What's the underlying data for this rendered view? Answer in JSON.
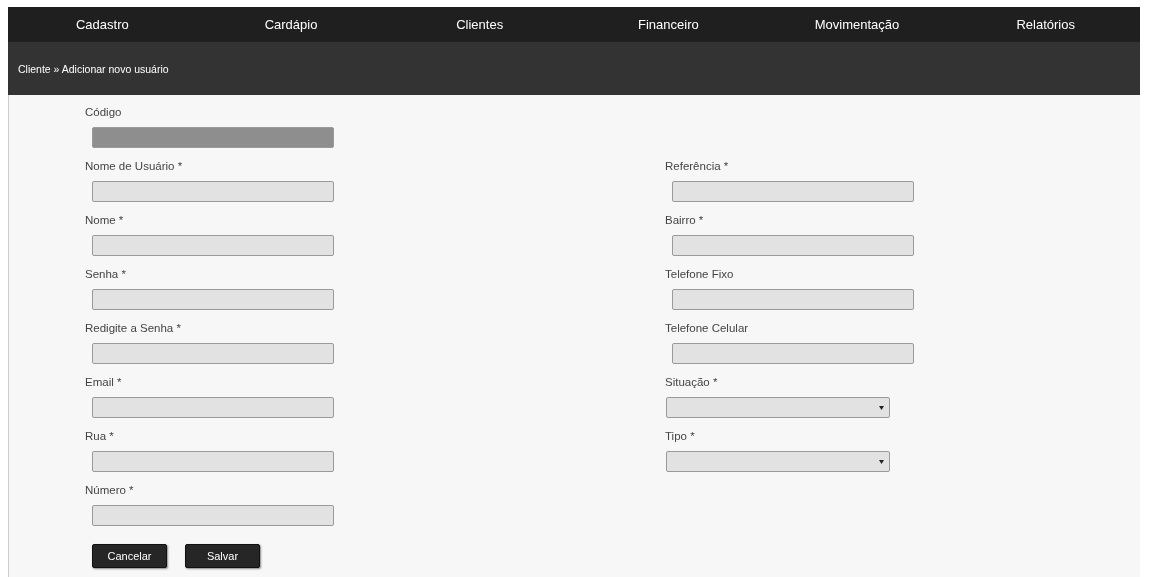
{
  "nav": {
    "items": [
      {
        "label": "Cadastro"
      },
      {
        "label": "Cardápio"
      },
      {
        "label": "Clientes"
      },
      {
        "label": "Financeiro"
      },
      {
        "label": "Movimentação"
      },
      {
        "label": "Relatórios"
      }
    ]
  },
  "breadcrumb": "Cliente » Adicionar novo usuário",
  "form": {
    "left": [
      {
        "label": "Código",
        "kind": "text",
        "disabled": true
      },
      {
        "label": "Nome de Usuário *",
        "kind": "text",
        "disabled": false
      },
      {
        "label": "Nome *",
        "kind": "text",
        "disabled": false
      },
      {
        "label": "Senha *",
        "kind": "text",
        "disabled": false
      },
      {
        "label": "Redigite a Senha *",
        "kind": "text",
        "disabled": false
      },
      {
        "label": "Email *",
        "kind": "text",
        "disabled": false
      },
      {
        "label": "Rua *",
        "kind": "text",
        "disabled": false
      },
      {
        "label": "Número *",
        "kind": "text",
        "disabled": false
      }
    ],
    "right": [
      {
        "label": "Referência *",
        "kind": "text",
        "disabled": false
      },
      {
        "label": "Bairro *",
        "kind": "text",
        "disabled": false
      },
      {
        "label": "Telefone Fixo",
        "kind": "text",
        "disabled": false
      },
      {
        "label": "Telefone Celular",
        "kind": "text",
        "disabled": false
      },
      {
        "label": "Situação *",
        "kind": "select",
        "disabled": false
      },
      {
        "label": "Tipo *",
        "kind": "select",
        "disabled": false
      }
    ],
    "buttons": [
      "Cancelar",
      "Salvar"
    ]
  }
}
